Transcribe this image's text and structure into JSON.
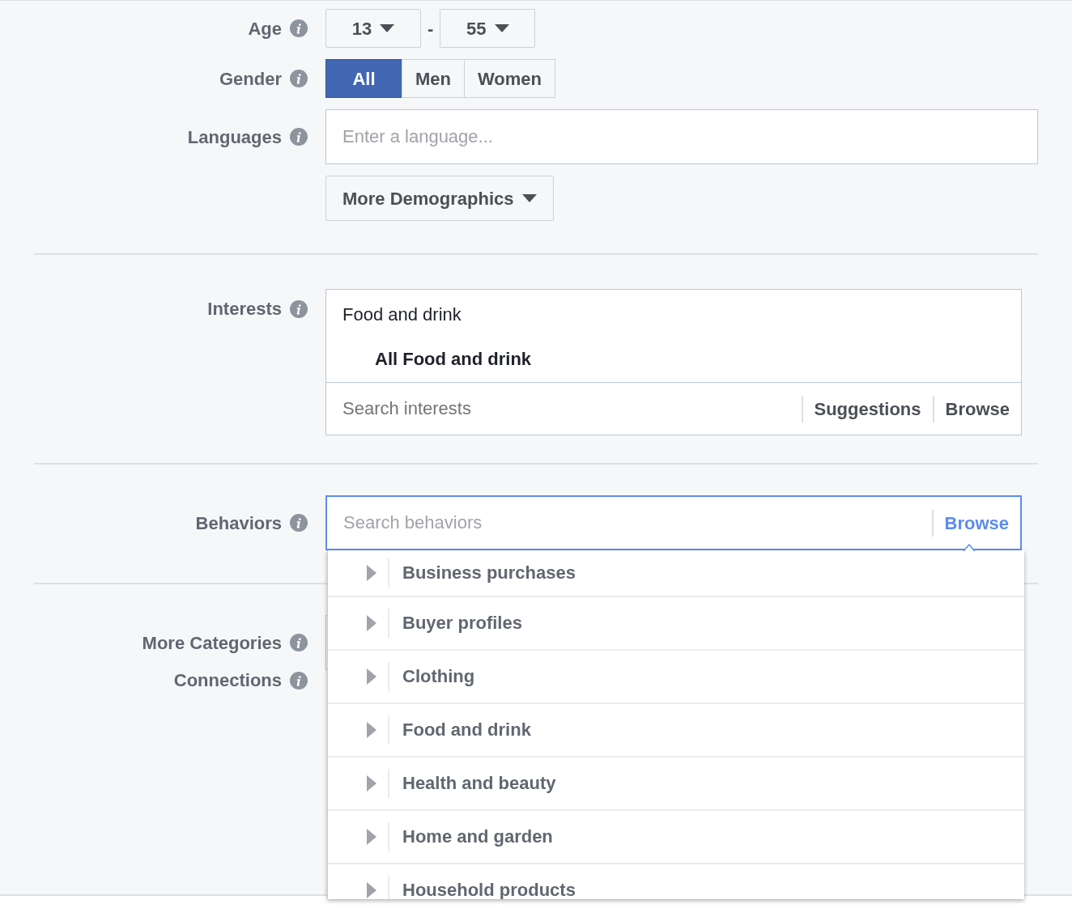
{
  "age": {
    "label": "Age",
    "min": "13",
    "separator": "-",
    "max": "55"
  },
  "gender": {
    "label": "Gender",
    "options": [
      {
        "label": "All",
        "selected": true
      },
      {
        "label": "Men",
        "selected": false
      },
      {
        "label": "Women",
        "selected": false
      }
    ]
  },
  "languages": {
    "label": "Languages",
    "placeholder": "Enter a language..."
  },
  "more_demographics": {
    "label": "More Demographics"
  },
  "interests": {
    "label": "Interests",
    "category": "Food and drink",
    "selected_item": "All Food and drink",
    "placeholder": "Search interests",
    "actions": [
      "Suggestions",
      "Browse"
    ]
  },
  "behaviors": {
    "label": "Behaviors",
    "placeholder": "Search behaviors",
    "browse": "Browse",
    "menu_items": [
      {
        "label": "Business purchases"
      },
      {
        "label": "Buyer profiles"
      },
      {
        "label": "Clothing"
      },
      {
        "label": "Food and drink"
      },
      {
        "label": "Health and beauty"
      },
      {
        "label": "Home and garden"
      },
      {
        "label": "Household products"
      }
    ]
  },
  "more_categories": {
    "label": "More Categories"
  },
  "connections": {
    "label": "Connections"
  }
}
